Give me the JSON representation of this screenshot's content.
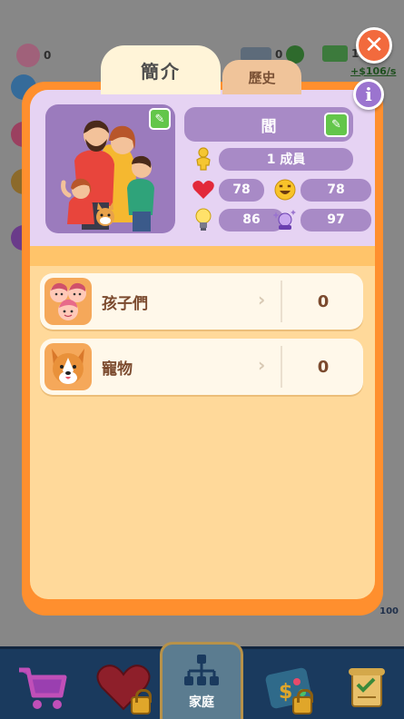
{
  "tabs": {
    "intro_label": "簡介",
    "history_label": "歷史"
  },
  "background": {
    "top_counter": "0",
    "money": "10",
    "income": "+$106/s",
    "side_value": "0",
    "bottom_value": "100"
  },
  "profile": {
    "name": "閻",
    "members": "1 成員",
    "stats": {
      "heart": "78",
      "happy": "78",
      "idea": "86",
      "magic": "97"
    }
  },
  "list": [
    {
      "label": "孩子們",
      "count": "0",
      "icon": "children-faces-icon"
    },
    {
      "label": "寵物",
      "count": "0",
      "icon": "corgi-dog-icon"
    }
  ],
  "nav": {
    "active_label": "家庭",
    "items": [
      "shop-cart-icon",
      "heart-icon",
      "family-tree-icon",
      "lottery-ticket-icon",
      "scroll-icon"
    ]
  },
  "colors": {
    "panel_orange": "#ff8f2e",
    "panel_cream": "#ffd99a",
    "header_lavender": "#e6d3f3",
    "pill_purple": "#a88ac6",
    "close_orange": "#f26a3d",
    "info_purple": "#9b74cf",
    "edit_green": "#63c64a",
    "nav_navy": "#1a3a5e"
  }
}
